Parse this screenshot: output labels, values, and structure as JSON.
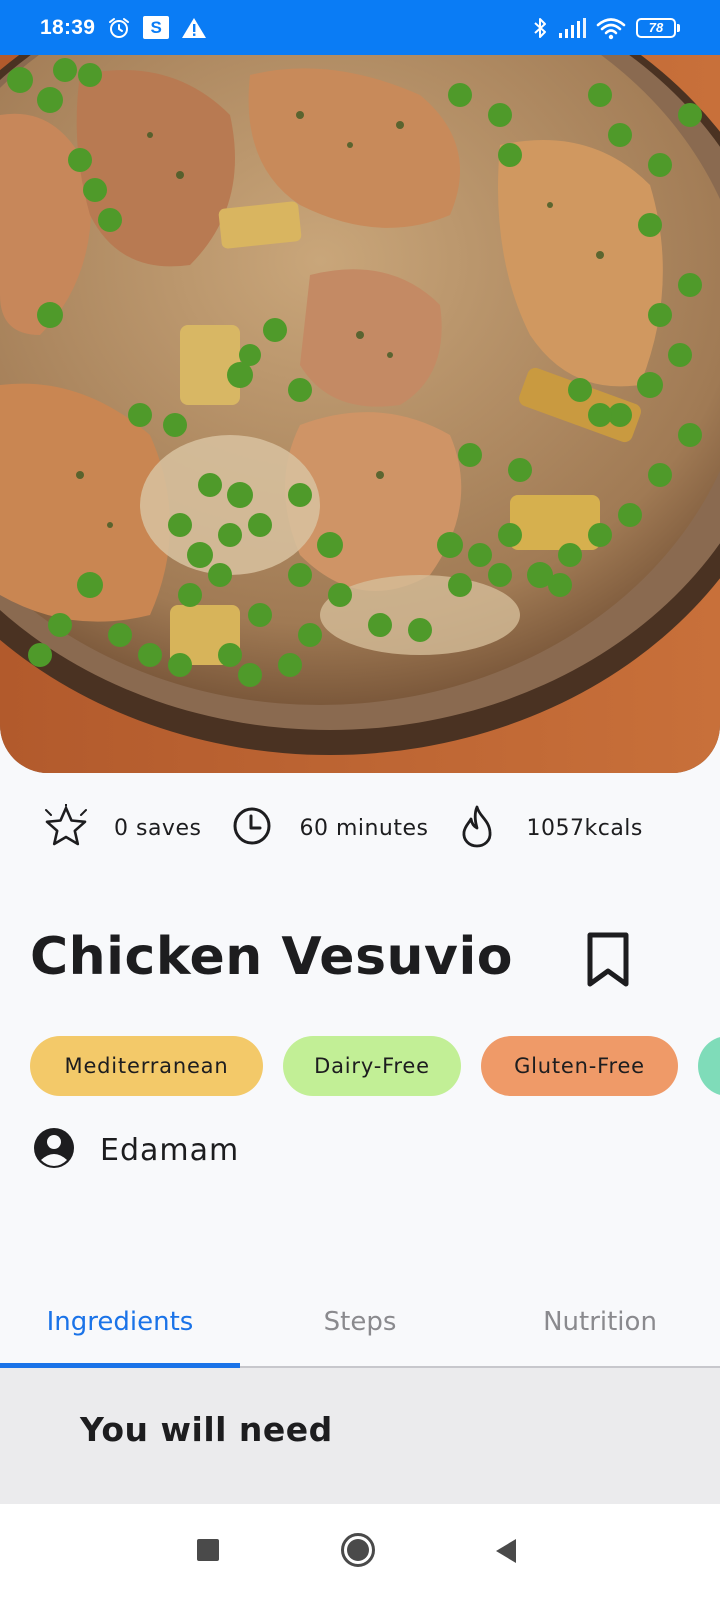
{
  "status_bar": {
    "time": "18:39",
    "icons": [
      "alarm-icon",
      "s-app-icon",
      "warning-icon",
      "bluetooth-icon",
      "signal-icon",
      "wifi-icon",
      "battery-icon"
    ],
    "s_badge": "S",
    "battery": "78",
    "background": "#0a7cf5"
  },
  "hero": {
    "image": "chicken-vesuvio-photo"
  },
  "stats": {
    "saves": "0 saves",
    "time": "60 minutes",
    "calories": "1057kcals"
  },
  "recipe": {
    "title": "Chicken Vesuvio",
    "source": "Edamam"
  },
  "tags": [
    {
      "label": "Mediterranean",
      "color": "#f3c969"
    },
    {
      "label": "Dairy-Free",
      "color": "#c2ef96"
    },
    {
      "label": "Gluten-Free",
      "color": "#ef9a68"
    },
    {
      "label": "",
      "color": "#7fdcb9"
    }
  ],
  "tabs": [
    {
      "label": "Ingredients",
      "active": true
    },
    {
      "label": "Steps",
      "active": false
    },
    {
      "label": "Nutrition",
      "active": false
    }
  ],
  "section": {
    "title": "You will need"
  },
  "colors": {
    "accent": "#1a73e8",
    "text": "#1d1d1f",
    "muted": "#8a8a8e"
  }
}
